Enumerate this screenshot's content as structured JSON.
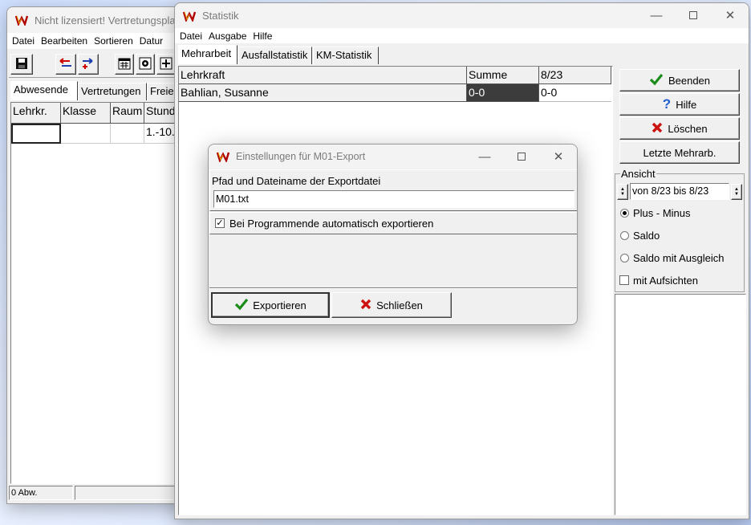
{
  "back_window": {
    "title": "Nicht lizensiert! Vertretungsplan f",
    "menu": [
      "Datei",
      "Bearbeiten",
      "Sortieren",
      "Datur"
    ],
    "tabs": [
      "Abwesende",
      "Vertretungen",
      "Freie"
    ],
    "columns": [
      "Lehrkr.",
      "Klasse",
      "Raum",
      "Stund"
    ],
    "row_value": "1.-10.",
    "status": "0 Abw."
  },
  "statistik_window": {
    "title": "Statistik",
    "menu": [
      "Datei",
      "Ausgabe",
      "Hilfe"
    ],
    "tabs": [
      "Mehrarbeit",
      "Ausfallstatistik",
      "KM-Statistik"
    ],
    "table": {
      "headers": [
        "Lehrkraft",
        "Summe",
        "8/23"
      ],
      "rows": [
        [
          "Bahlian, Susanne",
          "0-0",
          "0-0"
        ]
      ]
    },
    "buttons": {
      "beenden": "Beenden",
      "hilfe": "Hilfe",
      "loeschen": "Löschen",
      "letzte": "Letzte Mehrarb."
    },
    "ansicht": {
      "label": "Ansicht",
      "range": "von 8/23 bis 8/23",
      "radio_plus_minus": "Plus - Minus",
      "radio_saldo": "Saldo",
      "radio_saldo_ausgleich": "Saldo mit Ausgleich",
      "checkbox_aufsichten": "mit Aufsichten",
      "selected": "Plus - Minus"
    }
  },
  "dialog": {
    "title": "Einstellungen für M01-Export",
    "path_label": "Pfad und Dateiname der Exportdatei",
    "path_value": "M01.txt",
    "auto_export_label": "Bei Programmende automatisch exportieren",
    "auto_export_checked": true,
    "export_button": "Exportieren",
    "close_button": "Schließen"
  },
  "colors": {
    "check_green": "#1a8c1a",
    "x_red": "#cc1111",
    "help_blue": "#1f5fd0",
    "selected_cell": "#3c3c3c"
  }
}
